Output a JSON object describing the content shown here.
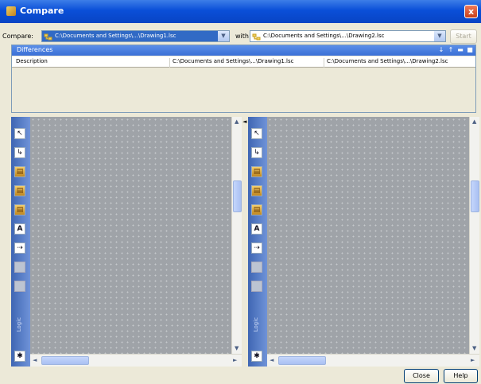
{
  "window": {
    "title": "Compare",
    "close_glyph": "x"
  },
  "toolbar": {
    "compare_label": "Compare:",
    "left_path": "C:\\Documents and Settings\\...\\Drawing1.lsc",
    "with_label": "with",
    "right_path": "C:\\Documents and Settings\\...\\Drawing2.lsc",
    "start_label": "Start"
  },
  "differences": {
    "title": "Differences",
    "columns": [
      "Description",
      "C:\\Documents and Settings\\...\\Drawing1.lsc",
      "C:\\Documents and Settings\\...\\Drawing2.lsc"
    ]
  },
  "palette": {
    "label": "Logic",
    "tools": [
      "select-icon",
      "connector-icon",
      "function-block-icon",
      "function-block-icon",
      "function-block-icon",
      "text-icon",
      "link-icon",
      "grey-block-icon",
      "grey-block-icon"
    ]
  },
  "footer": {
    "close_label": "Close",
    "help_label": "Help"
  },
  "colors": {
    "titlebar": "#0a4fd8",
    "canvas": "#9fa3a8",
    "palette": "#4f74c0"
  }
}
